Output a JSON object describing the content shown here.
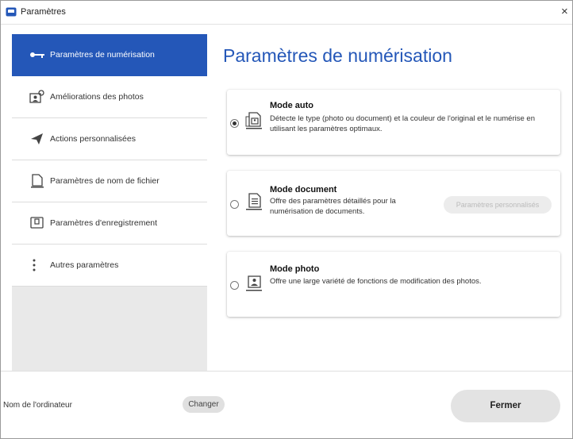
{
  "window": {
    "title": "Paramètres",
    "close_glyph": "×"
  },
  "sidebar": {
    "items": [
      {
        "label": "Paramètres de numérisation",
        "icon": "key-icon",
        "active": true
      },
      {
        "label": "Améliorations des photos",
        "icon": "photo-enhance-icon",
        "active": false
      },
      {
        "label": "Actions personnalisées",
        "icon": "send-icon",
        "active": false
      },
      {
        "label": "Paramètres de nom de fichier",
        "icon": "file-icon",
        "active": false
      },
      {
        "label": "Paramètres d'enregistrement",
        "icon": "save-icon",
        "active": false
      },
      {
        "label": "Autres paramètres",
        "icon": "more-vertical-icon",
        "active": false
      }
    ]
  },
  "main": {
    "title": "Paramètres de numérisation",
    "modes": [
      {
        "title": "Mode auto",
        "description": "Détecte le type (photo ou document) et la couleur de l'original et le numérise en utilisant les paramètres optimaux.",
        "selected": true,
        "icon": "auto-mode-icon"
      },
      {
        "title": "Mode document",
        "description": "Offre des paramètres détaillés pour la numérisation de documents.",
        "selected": false,
        "icon": "document-mode-icon",
        "button_label": "Paramètres personnalisés"
      },
      {
        "title": "Mode photo",
        "description": "Offre une large variété de fonctions de modification des photos.",
        "selected": false,
        "icon": "photo-mode-icon"
      }
    ]
  },
  "footer": {
    "computer_label": "Nom de l'ordinateur",
    "change_label": "Changer",
    "close_label": "Fermer"
  },
  "colors": {
    "accent": "#2457b8",
    "sidebar_bg": "#e9e9e9"
  }
}
